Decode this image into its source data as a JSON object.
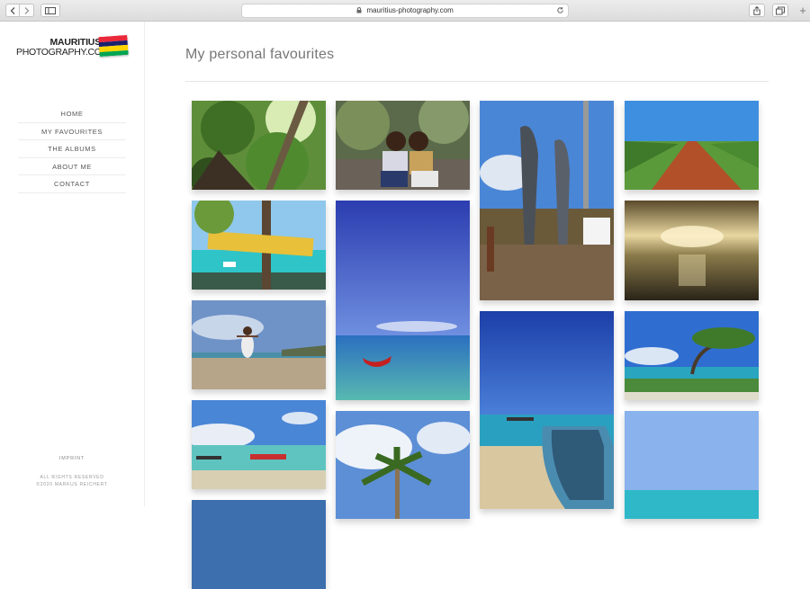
{
  "browser": {
    "url": "mauritius-photography.com",
    "back_icon": "chevron-left-icon",
    "forward_icon": "chevron-right-icon",
    "sidebar_icon": "sidebar-icon",
    "lock_icon": "lock-icon",
    "reload_icon": "reload-icon",
    "share_icon": "share-icon",
    "tabs_icon": "tabs-icon",
    "new_tab_label": "+"
  },
  "logo": {
    "line1": "MAURITIUS",
    "line2": "PHOTOGRAPHY.COM",
    "flag_colors": [
      "#ea2839",
      "#1a206d",
      "#ffd500",
      "#00a551"
    ]
  },
  "nav": {
    "items": [
      {
        "label": "HOME"
      },
      {
        "label": "MY FAVOURITES"
      },
      {
        "label": "THE ALBUMS"
      },
      {
        "label": "ABOUT ME"
      },
      {
        "label": "CONTACT"
      }
    ]
  },
  "footer": {
    "imprint": "IMPRINT",
    "rights": "ALL RIGHTS RESERVED",
    "copyright": "©2020 MARKUS REICHERT"
  },
  "page": {
    "title": "My personal favourites"
  }
}
